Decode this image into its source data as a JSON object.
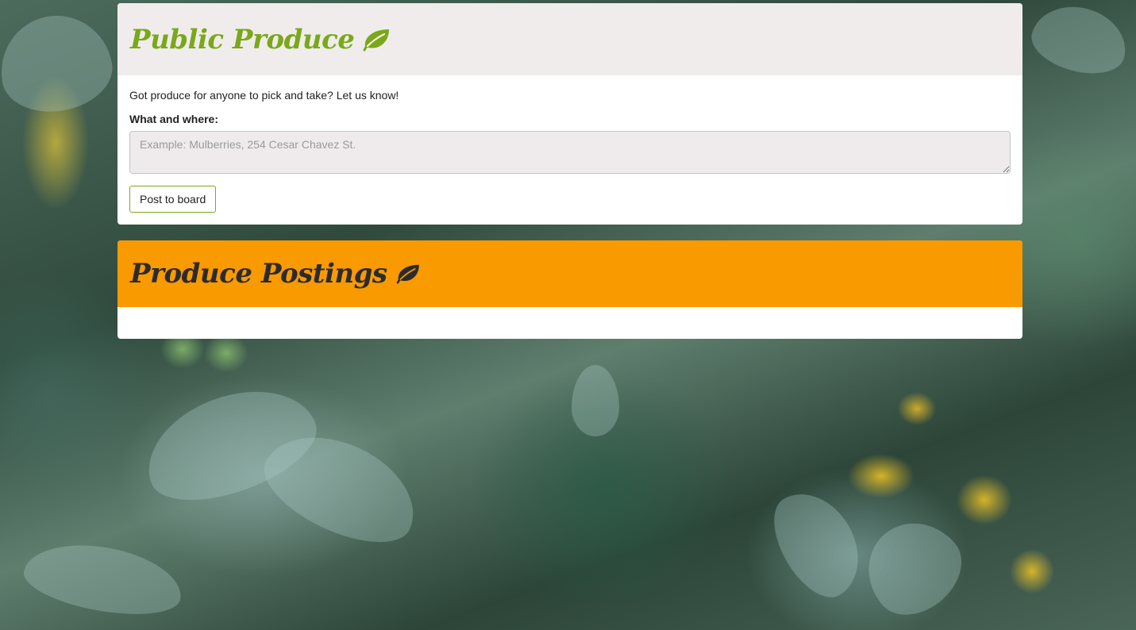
{
  "colors": {
    "brand_green": "#7aa81a",
    "header_orange": "#f99a00",
    "header_light": "#f0ecec",
    "textarea_bg": "#efebec"
  },
  "submit_card": {
    "title": "Public Produce",
    "title_icon": "leaf-icon",
    "intro": "Got produce for anyone to pick and take? Let us know!",
    "field_label": "What and where:",
    "field_placeholder": "Example: Mulberries, 254 Cesar Chavez St.",
    "field_value": "",
    "button_label": "Post to board"
  },
  "postings_card": {
    "title": "Produce Postings",
    "title_icon": "leaf-icon",
    "postings": []
  },
  "background": {
    "description_icon": "foliage-photo"
  }
}
